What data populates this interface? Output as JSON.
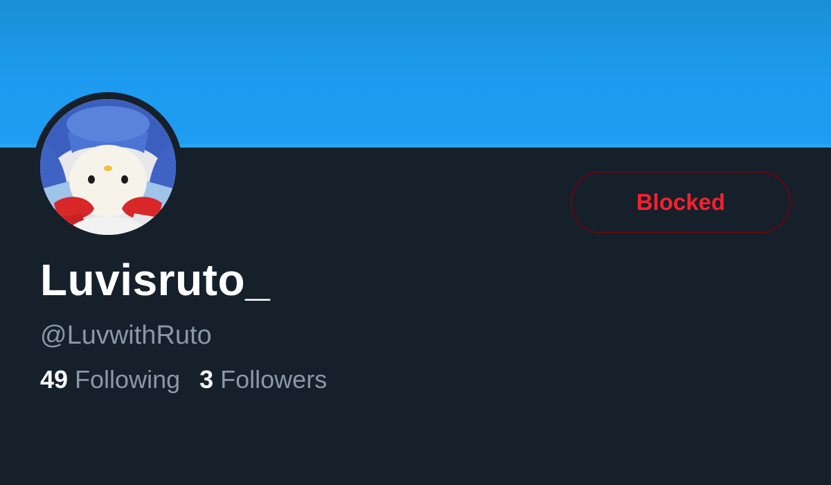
{
  "profile": {
    "display_name": "Luvisruto_",
    "handle": "@LuvwithRuto",
    "avatar_icon": "plush-penguin-avatar"
  },
  "actions": {
    "blocked_label": "Blocked"
  },
  "stats": {
    "following_count": "49",
    "following_label": "Following",
    "followers_count": "3",
    "followers_label": "Followers"
  },
  "colors": {
    "banner": "#1d9bf0",
    "background": "#15202b",
    "blocked_text": "#f4212e",
    "blocked_border": "#67070f",
    "secondary_text": "#8b98a5"
  }
}
